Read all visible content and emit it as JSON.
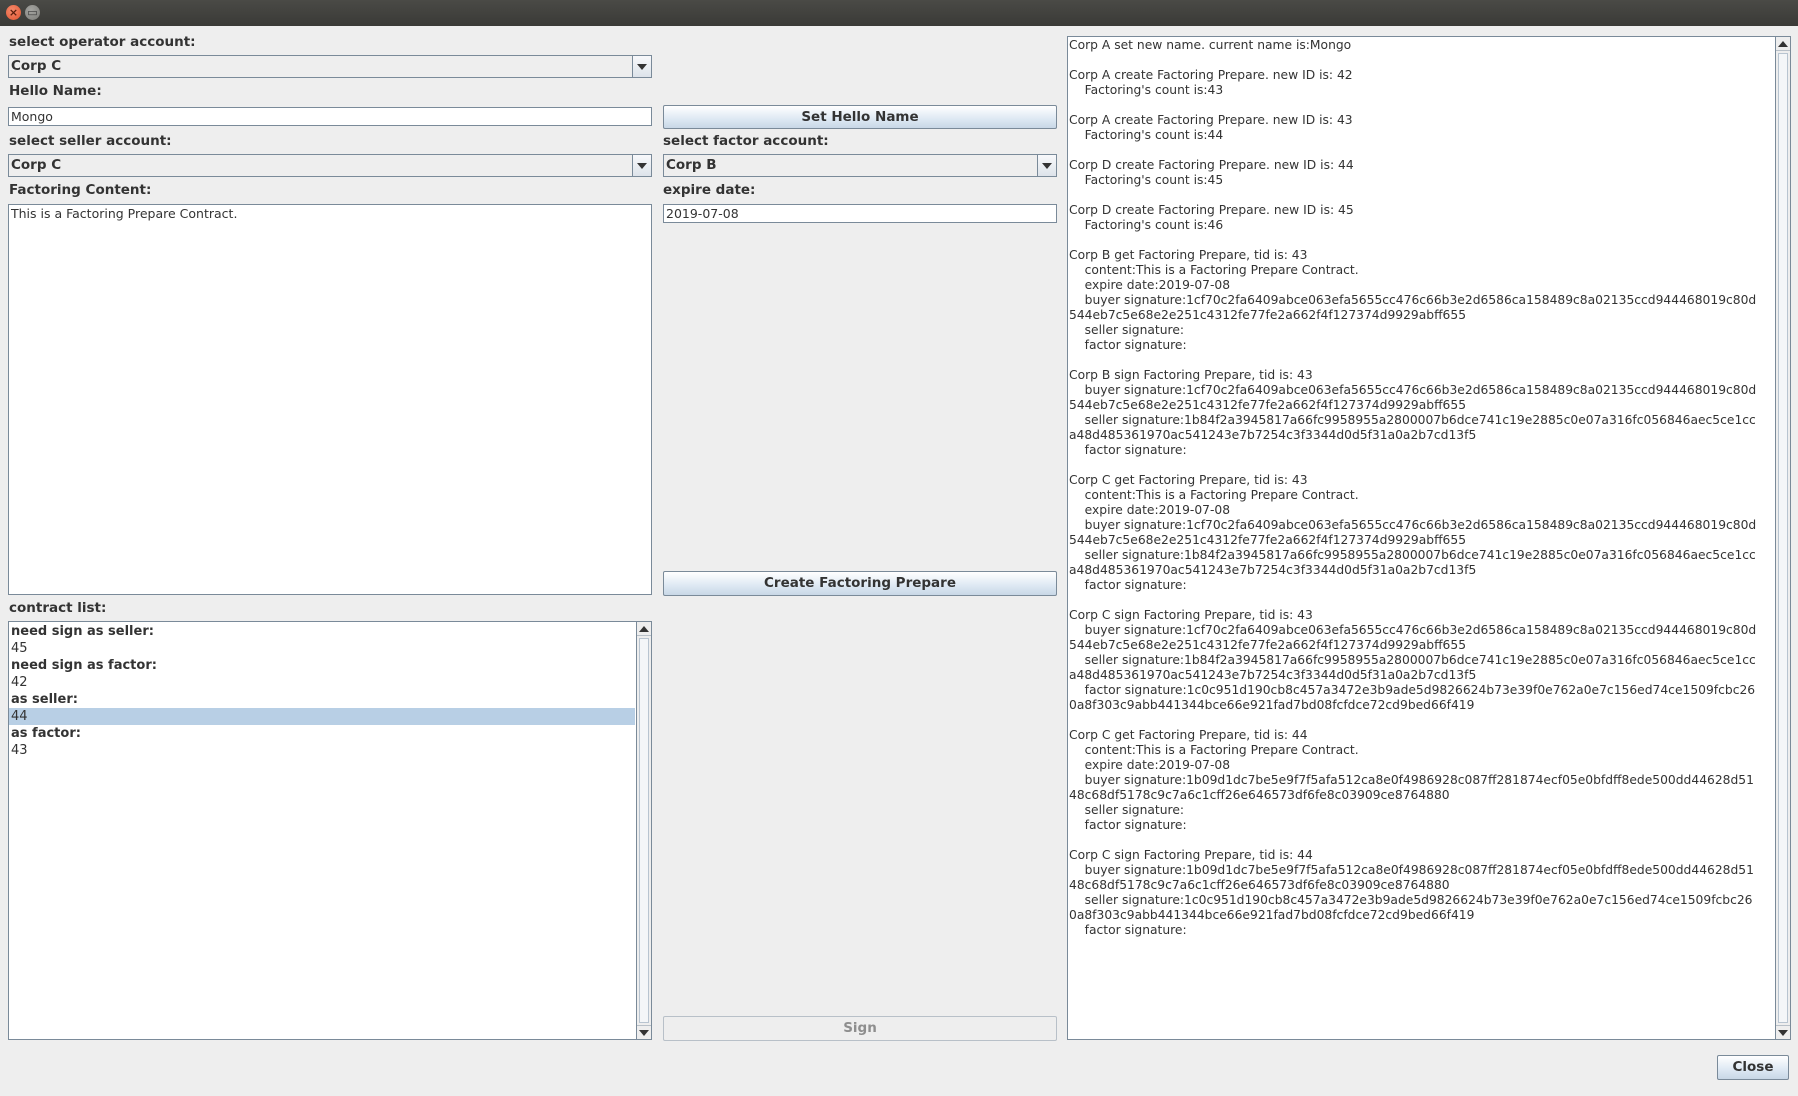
{
  "window": {
    "close_glyph": "×",
    "maximize_glyph": "▭",
    "close_label": "Close"
  },
  "operator": {
    "label": "select operator account:",
    "selected": "Corp C"
  },
  "hello": {
    "label": "Hello Name:",
    "value": "Mongo",
    "button": "Set Hello Name"
  },
  "seller": {
    "label": "select seller account:",
    "selected": "Corp C"
  },
  "factor": {
    "label": "select factor account:",
    "selected": "Corp B"
  },
  "content": {
    "label": "Factoring Content:",
    "value": "This is a Factoring Prepare Contract."
  },
  "expire": {
    "label": "expire date:",
    "value": "2019-07-08"
  },
  "create_button": "Create Factoring Prepare",
  "sign_button": "Sign",
  "contract_list": {
    "label": "contract list:",
    "items": [
      {
        "text": "need sign as seller:",
        "header": true,
        "selected": false
      },
      {
        "text": "45",
        "header": false,
        "selected": false
      },
      {
        "text": "need sign as factor:",
        "header": true,
        "selected": false
      },
      {
        "text": "42",
        "header": false,
        "selected": false
      },
      {
        "text": "as seller:",
        "header": true,
        "selected": false
      },
      {
        "text": "44",
        "header": false,
        "selected": true
      },
      {
        "text": "as factor:",
        "header": true,
        "selected": false
      },
      {
        "text": "43",
        "header": false,
        "selected": false
      }
    ]
  },
  "log": "Corp A set new name. current name is:Mongo\n\nCorp A create Factoring Prepare. new ID is: 42\n    Factoring's count is:43\n\nCorp A create Factoring Prepare. new ID is: 43\n    Factoring's count is:44\n\nCorp D create Factoring Prepare. new ID is: 44\n    Factoring's count is:45\n\nCorp D create Factoring Prepare. new ID is: 45\n    Factoring's count is:46\n\nCorp B get Factoring Prepare, tid is: 43\n    content:This is a Factoring Prepare Contract.\n    expire date:2019-07-08\n    buyer signature:1cf70c2fa6409abce063efa5655cc476c66b3e2d6586ca158489c8a02135ccd944468019c80d\n544eb7c5e68e2e251c4312fe77fe2a662f4f127374d9929abff655\n    seller signature:\n    factor signature:\n\nCorp B sign Factoring Prepare, tid is: 43\n    buyer signature:1cf70c2fa6409abce063efa5655cc476c66b3e2d6586ca158489c8a02135ccd944468019c80d\n544eb7c5e68e2e251c4312fe77fe2a662f4f127374d9929abff655\n    seller signature:1b84f2a3945817a66fc9958955a2800007b6dce741c19e2885c0e07a316fc056846aec5ce1cc\na48d485361970ac541243e7b7254c3f3344d0d5f31a0a2b7cd13f5\n    factor signature:\n\nCorp C get Factoring Prepare, tid is: 43\n    content:This is a Factoring Prepare Contract.\n    expire date:2019-07-08\n    buyer signature:1cf70c2fa6409abce063efa5655cc476c66b3e2d6586ca158489c8a02135ccd944468019c80d\n544eb7c5e68e2e251c4312fe77fe2a662f4f127374d9929abff655\n    seller signature:1b84f2a3945817a66fc9958955a2800007b6dce741c19e2885c0e07a316fc056846aec5ce1cc\na48d485361970ac541243e7b7254c3f3344d0d5f31a0a2b7cd13f5\n    factor signature:\n\nCorp C sign Factoring Prepare, tid is: 43\n    buyer signature:1cf70c2fa6409abce063efa5655cc476c66b3e2d6586ca158489c8a02135ccd944468019c80d\n544eb7c5e68e2e251c4312fe77fe2a662f4f127374d9929abff655\n    seller signature:1b84f2a3945817a66fc9958955a2800007b6dce741c19e2885c0e07a316fc056846aec5ce1cc\na48d485361970ac541243e7b7254c3f3344d0d5f31a0a2b7cd13f5\n    factor signature:1c0c951d190cb8c457a3472e3b9ade5d9826624b73e39f0e762a0e7c156ed74ce1509fcbc26\n0a8f303c9abb441344bce66e921fad7bd08fcfdce72cd9bed66f419\n\nCorp C get Factoring Prepare, tid is: 44\n    content:This is a Factoring Prepare Contract.\n    expire date:2019-07-08\n    buyer signature:1b09d1dc7be5e9f7f5afa512ca8e0f4986928c087ff281874ecf05e0bfdff8ede500dd44628d51\n48c68df5178c9c7a6c1cff26e646573df6fe8c03909ce8764880\n    seller signature:\n    factor signature:\n\nCorp C sign Factoring Prepare, tid is: 44\n    buyer signature:1b09d1dc7be5e9f7f5afa512ca8e0f4986928c087ff281874ecf05e0bfdff8ede500dd44628d51\n48c68df5178c9c7a6c1cff26e646573df6fe8c03909ce8764880\n    seller signature:1c0c951d190cb8c457a3472e3b9ade5d9826624b73e39f0e762a0e7c156ed74ce1509fcbc26\n0a8f303c9abb441344bce66e921fad7bd08fcfdce72cd9bed66f419\n    factor signature:"
}
